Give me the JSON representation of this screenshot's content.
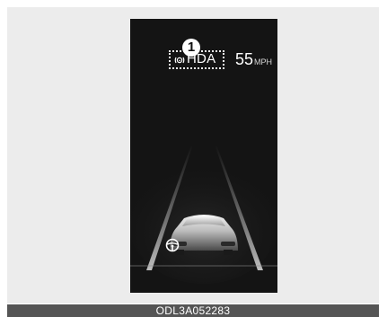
{
  "hud": {
    "callout_number": "1",
    "hda_label": "HDA",
    "speed_value": "55",
    "speed_unit": "MPH"
  },
  "icons": {
    "hda_icon": "steering-wheel-icon",
    "assist_icon": "steering-wheel-icon"
  },
  "caption": "ODL3A052283",
  "colors": {
    "display_bg": "#141414",
    "frame_bg": "#ececec",
    "caption_bg": "#555555",
    "text": "#ffffff"
  }
}
